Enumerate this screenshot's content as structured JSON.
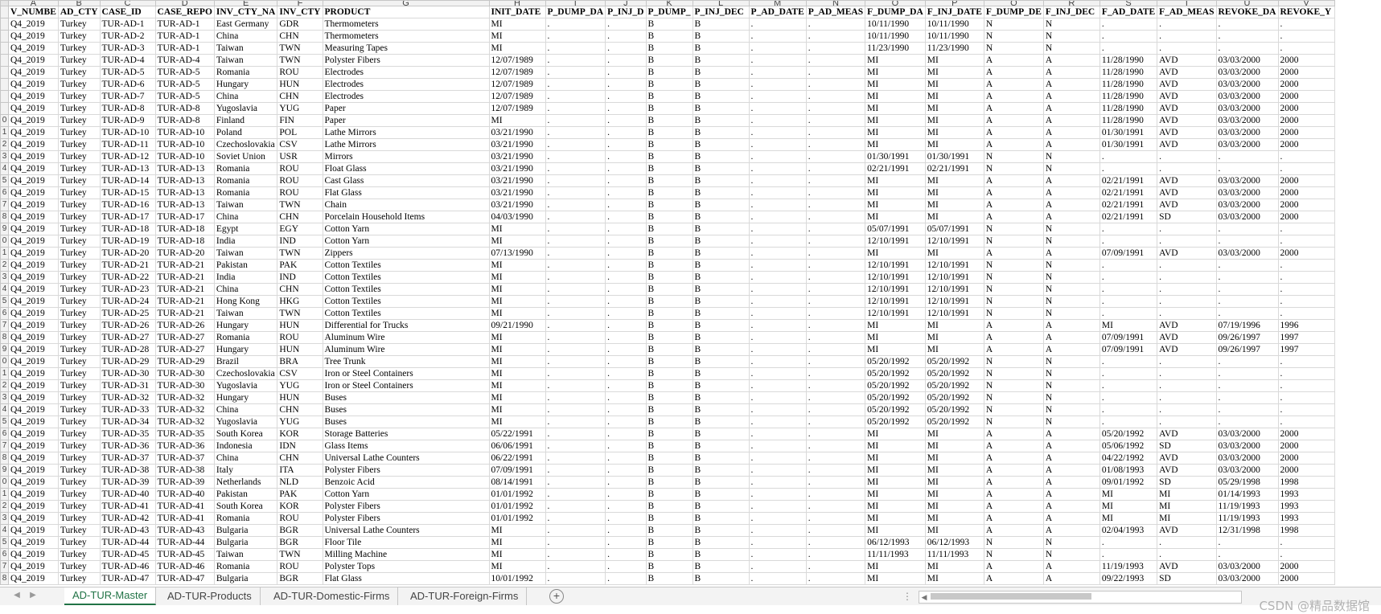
{
  "columns": [
    "A",
    "B",
    "C",
    "D",
    "E",
    "F",
    "G",
    "H",
    "I",
    "J",
    "K",
    "L",
    "M",
    "N",
    "O",
    "P",
    "Q",
    "R",
    "S",
    "T",
    "U",
    "V"
  ],
  "headers": [
    "V_NUMBE",
    "AD_CTY",
    "CASE_ID",
    "CASE_REPO",
    "INV_CTY_NA",
    "INV_CTY",
    "PRODUCT",
    "INIT_DATE",
    "P_DUMP_DA",
    "P_INJ_D",
    "P_DUMP_",
    "P_INJ_DEC",
    "P_AD_DATE",
    "P_AD_MEAS",
    "F_DUMP_DA",
    "F_INJ_DATE",
    "F_DUMP_DE",
    "F_INJ_DEC",
    "F_AD_DATE",
    "F_AD_MEAS",
    "REVOKE_DA",
    "REVOKE_Y"
  ],
  "row_numbers": [
    "",
    "",
    "",
    "",
    "",
    "",
    "",
    "",
    "",
    "0",
    "1",
    "2",
    "3",
    "4",
    "5",
    "6",
    "7",
    "8",
    "9",
    "0",
    "1",
    "2",
    "3",
    "4",
    "5",
    "6",
    "7",
    "8",
    "9",
    "0",
    "1",
    "2",
    "3",
    "4",
    "5",
    "6",
    "7",
    "8",
    "9",
    "0",
    "1",
    "2",
    "3",
    "4",
    "5",
    "6",
    "7",
    "8"
  ],
  "rows": [
    [
      "Q4_2019",
      "Turkey",
      "TUR-AD-1",
      "TUR-AD-1",
      "East Germany",
      "GDR",
      "Thermometers",
      "MI",
      ".",
      ".",
      "B",
      "B",
      ".",
      ".",
      "10/11/1990",
      "10/11/1990",
      "N",
      "N",
      ".",
      ".",
      ".",
      "."
    ],
    [
      "Q4_2019",
      "Turkey",
      "TUR-AD-2",
      "TUR-AD-1",
      "China",
      "CHN",
      "Thermometers",
      "MI",
      ".",
      ".",
      "B",
      "B",
      ".",
      ".",
      "10/11/1990",
      "10/11/1990",
      "N",
      "N",
      ".",
      ".",
      ".",
      "."
    ],
    [
      "Q4_2019",
      "Turkey",
      "TUR-AD-3",
      "TUR-AD-1",
      "Taiwan",
      "TWN",
      "Measuring Tapes",
      "MI",
      ".",
      ".",
      "B",
      "B",
      ".",
      ".",
      "11/23/1990",
      "11/23/1990",
      "N",
      "N",
      ".",
      ".",
      ".",
      "."
    ],
    [
      "Q4_2019",
      "Turkey",
      "TUR-AD-4",
      "TUR-AD-4",
      "Taiwan",
      "TWN",
      "Polyster Fibers",
      "12/07/1989",
      ".",
      ".",
      "B",
      "B",
      ".",
      ".",
      "MI",
      "MI",
      "A",
      "A",
      "11/28/1990",
      "AVD",
      "03/03/2000",
      "2000"
    ],
    [
      "Q4_2019",
      "Turkey",
      "TUR-AD-5",
      "TUR-AD-5",
      "Romania",
      "ROU",
      "Electrodes",
      "12/07/1989",
      ".",
      ".",
      "B",
      "B",
      ".",
      ".",
      "MI",
      "MI",
      "A",
      "A",
      "11/28/1990",
      "AVD",
      "03/03/2000",
      "2000"
    ],
    [
      "Q4_2019",
      "Turkey",
      "TUR-AD-6",
      "TUR-AD-5",
      "Hungary",
      "HUN",
      "Electrodes",
      "12/07/1989",
      ".",
      ".",
      "B",
      "B",
      ".",
      ".",
      "MI",
      "MI",
      "A",
      "A",
      "11/28/1990",
      "AVD",
      "03/03/2000",
      "2000"
    ],
    [
      "Q4_2019",
      "Turkey",
      "TUR-AD-7",
      "TUR-AD-5",
      "China",
      "CHN",
      "Electrodes",
      "12/07/1989",
      ".",
      ".",
      "B",
      "B",
      ".",
      ".",
      "MI",
      "MI",
      "A",
      "A",
      "11/28/1990",
      "AVD",
      "03/03/2000",
      "2000"
    ],
    [
      "Q4_2019",
      "Turkey",
      "TUR-AD-8",
      "TUR-AD-8",
      "Yugoslavia",
      "YUG",
      "Paper",
      "12/07/1989",
      ".",
      ".",
      "B",
      "B",
      ".",
      ".",
      "MI",
      "MI",
      "A",
      "A",
      "11/28/1990",
      "AVD",
      "03/03/2000",
      "2000"
    ],
    [
      "Q4_2019",
      "Turkey",
      "TUR-AD-9",
      "TUR-AD-8",
      "Finland",
      "FIN",
      "Paper",
      "MI",
      ".",
      ".",
      "B",
      "B",
      ".",
      ".",
      "MI",
      "MI",
      "A",
      "A",
      "11/28/1990",
      "AVD",
      "03/03/2000",
      "2000"
    ],
    [
      "Q4_2019",
      "Turkey",
      "TUR-AD-10",
      "TUR-AD-10",
      "Poland",
      "POL",
      "Lathe Mirrors",
      "03/21/1990",
      ".",
      ".",
      "B",
      "B",
      ".",
      ".",
      "MI",
      "MI",
      "A",
      "A",
      "01/30/1991",
      "AVD",
      "03/03/2000",
      "2000"
    ],
    [
      "Q4_2019",
      "Turkey",
      "TUR-AD-11",
      "TUR-AD-10",
      "Czechoslovakia",
      "CSV",
      "Lathe Mirrors",
      "03/21/1990",
      ".",
      ".",
      "B",
      "B",
      ".",
      ".",
      "MI",
      "MI",
      "A",
      "A",
      "01/30/1991",
      "AVD",
      "03/03/2000",
      "2000"
    ],
    [
      "Q4_2019",
      "Turkey",
      "TUR-AD-12",
      "TUR-AD-10",
      "Soviet Union",
      "USR",
      "Mirrors",
      "03/21/1990",
      ".",
      ".",
      "B",
      "B",
      ".",
      ".",
      "01/30/1991",
      "01/30/1991",
      "N",
      "N",
      ".",
      ".",
      ".",
      "."
    ],
    [
      "Q4_2019",
      "Turkey",
      "TUR-AD-13",
      "TUR-AD-13",
      "Romania",
      "ROU",
      "Float Glass",
      "03/21/1990",
      ".",
      ".",
      "B",
      "B",
      ".",
      ".",
      "02/21/1991",
      "02/21/1991",
      "N",
      "N",
      ".",
      ".",
      ".",
      "."
    ],
    [
      "Q4_2019",
      "Turkey",
      "TUR-AD-14",
      "TUR-AD-13",
      "Romania",
      "ROU",
      "Cast Glass",
      "03/21/1990",
      ".",
      ".",
      "B",
      "B",
      ".",
      ".",
      "MI",
      "MI",
      "A",
      "A",
      "02/21/1991",
      "AVD",
      "03/03/2000",
      "2000"
    ],
    [
      "Q4_2019",
      "Turkey",
      "TUR-AD-15",
      "TUR-AD-13",
      "Romania",
      "ROU",
      "Flat Glass",
      "03/21/1990",
      ".",
      ".",
      "B",
      "B",
      ".",
      ".",
      "MI",
      "MI",
      "A",
      "A",
      "02/21/1991",
      "AVD",
      "03/03/2000",
      "2000"
    ],
    [
      "Q4_2019",
      "Turkey",
      "TUR-AD-16",
      "TUR-AD-13",
      "Taiwan",
      "TWN",
      "Chain",
      "03/21/1990",
      ".",
      ".",
      "B",
      "B",
      ".",
      ".",
      "MI",
      "MI",
      "A",
      "A",
      "02/21/1991",
      "AVD",
      "03/03/2000",
      "2000"
    ],
    [
      "Q4_2019",
      "Turkey",
      "TUR-AD-17",
      "TUR-AD-17",
      "China",
      "CHN",
      "Porcelain Household Items",
      "04/03/1990",
      ".",
      ".",
      "B",
      "B",
      ".",
      ".",
      "MI",
      "MI",
      "A",
      "A",
      "02/21/1991",
      "SD",
      "03/03/2000",
      "2000"
    ],
    [
      "Q4_2019",
      "Turkey",
      "TUR-AD-18",
      "TUR-AD-18",
      "Egypt",
      "EGY",
      "Cotton Yarn",
      "MI",
      ".",
      ".",
      "B",
      "B",
      ".",
      ".",
      "05/07/1991",
      "05/07/1991",
      "N",
      "N",
      ".",
      ".",
      ".",
      "."
    ],
    [
      "Q4_2019",
      "Turkey",
      "TUR-AD-19",
      "TUR-AD-18",
      "India",
      "IND",
      "Cotton Yarn",
      "MI",
      ".",
      ".",
      "B",
      "B",
      ".",
      ".",
      "12/10/1991",
      "12/10/1991",
      "N",
      "N",
      ".",
      ".",
      ".",
      "."
    ],
    [
      "Q4_2019",
      "Turkey",
      "TUR-AD-20",
      "TUR-AD-20",
      "Taiwan",
      "TWN",
      "Zippers",
      "07/13/1990",
      ".",
      ".",
      "B",
      "B",
      ".",
      ".",
      "MI",
      "MI",
      "A",
      "A",
      "07/09/1991",
      "AVD",
      "03/03/2000",
      "2000"
    ],
    [
      "Q4_2019",
      "Turkey",
      "TUR-AD-21",
      "TUR-AD-21",
      "Pakistan",
      "PAK",
      "Cotton Textiles",
      "MI",
      ".",
      ".",
      "B",
      "B",
      ".",
      ".",
      "12/10/1991",
      "12/10/1991",
      "N",
      "N",
      ".",
      ".",
      ".",
      "."
    ],
    [
      "Q4_2019",
      "Turkey",
      "TUR-AD-22",
      "TUR-AD-21",
      "India",
      "IND",
      "Cotton Textiles",
      "MI",
      ".",
      ".",
      "B",
      "B",
      ".",
      ".",
      "12/10/1991",
      "12/10/1991",
      "N",
      "N",
      ".",
      ".",
      ".",
      "."
    ],
    [
      "Q4_2019",
      "Turkey",
      "TUR-AD-23",
      "TUR-AD-21",
      "China",
      "CHN",
      "Cotton Textiles",
      "MI",
      ".",
      ".",
      "B",
      "B",
      ".",
      ".",
      "12/10/1991",
      "12/10/1991",
      "N",
      "N",
      ".",
      ".",
      ".",
      "."
    ],
    [
      "Q4_2019",
      "Turkey",
      "TUR-AD-24",
      "TUR-AD-21",
      "Hong Kong",
      "HKG",
      "Cotton Textiles",
      "MI",
      ".",
      ".",
      "B",
      "B",
      ".",
      ".",
      "12/10/1991",
      "12/10/1991",
      "N",
      "N",
      ".",
      ".",
      ".",
      "."
    ],
    [
      "Q4_2019",
      "Turkey",
      "TUR-AD-25",
      "TUR-AD-21",
      "Taiwan",
      "TWN",
      "Cotton Textiles",
      "MI",
      ".",
      ".",
      "B",
      "B",
      ".",
      ".",
      "12/10/1991",
      "12/10/1991",
      "N",
      "N",
      ".",
      ".",
      ".",
      "."
    ],
    [
      "Q4_2019",
      "Turkey",
      "TUR-AD-26",
      "TUR-AD-26",
      "Hungary",
      "HUN",
      "Differential for Trucks",
      "09/21/1990",
      ".",
      ".",
      "B",
      "B",
      ".",
      ".",
      "MI",
      "MI",
      "A",
      "A",
      "MI",
      "AVD",
      "07/19/1996",
      "1996"
    ],
    [
      "Q4_2019",
      "Turkey",
      "TUR-AD-27",
      "TUR-AD-27",
      "Romania",
      "ROU",
      "Aluminum Wire",
      "MI",
      ".",
      ".",
      "B",
      "B",
      ".",
      ".",
      "MI",
      "MI",
      "A",
      "A",
      "07/09/1991",
      "AVD",
      "09/26/1997",
      "1997"
    ],
    [
      "Q4_2019",
      "Turkey",
      "TUR-AD-28",
      "TUR-AD-27",
      "Hungary",
      "HUN",
      "Aluminum Wire",
      "MI",
      ".",
      ".",
      "B",
      "B",
      ".",
      ".",
      "MI",
      "MI",
      "A",
      "A",
      "07/09/1991",
      "AVD",
      "09/26/1997",
      "1997"
    ],
    [
      "Q4_2019",
      "Turkey",
      "TUR-AD-29",
      "TUR-AD-29",
      "Brazil",
      "BRA",
      "Tree Trunk",
      "MI",
      ".",
      ".",
      "B",
      "B",
      ".",
      ".",
      "05/20/1992",
      "05/20/1992",
      "N",
      "N",
      ".",
      ".",
      ".",
      "."
    ],
    [
      "Q4_2019",
      "Turkey",
      "TUR-AD-30",
      "TUR-AD-30",
      "Czechoslovakia",
      "CSV",
      "Iron or Steel Containers",
      "MI",
      ".",
      ".",
      "B",
      "B",
      ".",
      ".",
      "05/20/1992",
      "05/20/1992",
      "N",
      "N",
      ".",
      ".",
      ".",
      "."
    ],
    [
      "Q4_2019",
      "Turkey",
      "TUR-AD-31",
      "TUR-AD-30",
      "Yugoslavia",
      "YUG",
      "Iron or Steel Containers",
      "MI",
      ".",
      ".",
      "B",
      "B",
      ".",
      ".",
      "05/20/1992",
      "05/20/1992",
      "N",
      "N",
      ".",
      ".",
      ".",
      "."
    ],
    [
      "Q4_2019",
      "Turkey",
      "TUR-AD-32",
      "TUR-AD-32",
      "Hungary",
      "HUN",
      "Buses",
      "MI",
      ".",
      ".",
      "B",
      "B",
      ".",
      ".",
      "05/20/1992",
      "05/20/1992",
      "N",
      "N",
      ".",
      ".",
      ".",
      "."
    ],
    [
      "Q4_2019",
      "Turkey",
      "TUR-AD-33",
      "TUR-AD-32",
      "China",
      "CHN",
      "Buses",
      "MI",
      ".",
      ".",
      "B",
      "B",
      ".",
      ".",
      "05/20/1992",
      "05/20/1992",
      "N",
      "N",
      ".",
      ".",
      ".",
      "."
    ],
    [
      "Q4_2019",
      "Turkey",
      "TUR-AD-34",
      "TUR-AD-32",
      "Yugoslavia",
      "YUG",
      "Buses",
      "MI",
      ".",
      ".",
      "B",
      "B",
      ".",
      ".",
      "05/20/1992",
      "05/20/1992",
      "N",
      "N",
      ".",
      ".",
      ".",
      "."
    ],
    [
      "Q4_2019",
      "Turkey",
      "TUR-AD-35",
      "TUR-AD-35",
      "South Korea",
      "KOR",
      "Storage Batteries",
      "05/22/1991",
      ".",
      ".",
      "B",
      "B",
      ".",
      ".",
      "MI",
      "MI",
      "A",
      "A",
      "05/20/1992",
      "AVD",
      "03/03/2000",
      "2000"
    ],
    [
      "Q4_2019",
      "Turkey",
      "TUR-AD-36",
      "TUR-AD-36",
      "Indonesia",
      "IDN",
      "Glass Items",
      "06/06/1991",
      ".",
      ".",
      "B",
      "B",
      ".",
      ".",
      "MI",
      "MI",
      "A",
      "A",
      "05/06/1992",
      "SD",
      "03/03/2000",
      "2000"
    ],
    [
      "Q4_2019",
      "Turkey",
      "TUR-AD-37",
      "TUR-AD-37",
      "China",
      "CHN",
      "Universal Lathe Counters",
      "06/22/1991",
      ".",
      ".",
      "B",
      "B",
      ".",
      ".",
      "MI",
      "MI",
      "A",
      "A",
      "04/22/1992",
      "AVD",
      "03/03/2000",
      "2000"
    ],
    [
      "Q4_2019",
      "Turkey",
      "TUR-AD-38",
      "TUR-AD-38",
      "Italy",
      "ITA",
      "Polyster Fibers",
      "07/09/1991",
      ".",
      ".",
      "B",
      "B",
      ".",
      ".",
      "MI",
      "MI",
      "A",
      "A",
      "01/08/1993",
      "AVD",
      "03/03/2000",
      "2000"
    ],
    [
      "Q4_2019",
      "Turkey",
      "TUR-AD-39",
      "TUR-AD-39",
      "Netherlands",
      "NLD",
      "Benzoic Acid",
      "08/14/1991",
      ".",
      ".",
      "B",
      "B",
      ".",
      ".",
      "MI",
      "MI",
      "A",
      "A",
      "09/01/1992",
      "SD",
      "05/29/1998",
      "1998"
    ],
    [
      "Q4_2019",
      "Turkey",
      "TUR-AD-40",
      "TUR-AD-40",
      "Pakistan",
      "PAK",
      "Cotton Yarn",
      "01/01/1992",
      ".",
      ".",
      "B",
      "B",
      ".",
      ".",
      "MI",
      "MI",
      "A",
      "A",
      "MI",
      "MI",
      "01/14/1993",
      "1993"
    ],
    [
      "Q4_2019",
      "Turkey",
      "TUR-AD-41",
      "TUR-AD-41",
      "South Korea",
      "KOR",
      "Polyster Fibers",
      "01/01/1992",
      ".",
      ".",
      "B",
      "B",
      ".",
      ".",
      "MI",
      "MI",
      "A",
      "A",
      "MI",
      "MI",
      "11/19/1993",
      "1993"
    ],
    [
      "Q4_2019",
      "Turkey",
      "TUR-AD-42",
      "TUR-AD-41",
      "Romania",
      "ROU",
      "Polyster Fibers",
      "01/01/1992",
      ".",
      ".",
      "B",
      "B",
      ".",
      ".",
      "MI",
      "MI",
      "A",
      "A",
      "MI",
      "MI",
      "11/19/1993",
      "1993"
    ],
    [
      "Q4_2019",
      "Turkey",
      "TUR-AD-43",
      "TUR-AD-43",
      "Bulgaria",
      "BGR",
      "Universal Lathe Counters",
      "MI",
      ".",
      ".",
      "B",
      "B",
      ".",
      ".",
      "MI",
      "MI",
      "A",
      "A",
      "02/04/1993",
      "AVD",
      "12/31/1998",
      "1998"
    ],
    [
      "Q4_2019",
      "Turkey",
      "TUR-AD-44",
      "TUR-AD-44",
      "Bulgaria",
      "BGR",
      "Floor Tile",
      "MI",
      ".",
      ".",
      "B",
      "B",
      ".",
      ".",
      "06/12/1993",
      "06/12/1993",
      "N",
      "N",
      ".",
      ".",
      ".",
      "."
    ],
    [
      "Q4_2019",
      "Turkey",
      "TUR-AD-45",
      "TUR-AD-45",
      "Taiwan",
      "TWN",
      "Milling Machine",
      "MI",
      ".",
      ".",
      "B",
      "B",
      ".",
      ".",
      "11/11/1993",
      "11/11/1993",
      "N",
      "N",
      ".",
      ".",
      ".",
      "."
    ],
    [
      "Q4_2019",
      "Turkey",
      "TUR-AD-46",
      "TUR-AD-46",
      "Romania",
      "ROU",
      "Polyster Tops",
      "MI",
      ".",
      ".",
      "B",
      "B",
      ".",
      ".",
      "MI",
      "MI",
      "A",
      "A",
      "11/19/1993",
      "AVD",
      "03/03/2000",
      "2000"
    ],
    [
      "Q4_2019",
      "Turkey",
      "TUR-AD-47",
      "TUR-AD-47",
      "Bulgaria",
      "BGR",
      "Flat Glass",
      "10/01/1992",
      ".",
      ".",
      "B",
      "B",
      ".",
      ".",
      "MI",
      "MI",
      "A",
      "A",
      "09/22/1993",
      "SD",
      "03/03/2000",
      "2000"
    ]
  ],
  "tabs": [
    "AD-TUR-Master",
    "AD-TUR-Products",
    "AD-TUR-Domestic-Firms",
    "AD-TUR-Foreign-Firms"
  ],
  "active_tab": 0,
  "watermark": "CSDN @精品数据馆",
  "colors": {
    "active_tab": "#217346",
    "grid": "#d9d9d9",
    "header_bg": "#f2f2f2"
  }
}
